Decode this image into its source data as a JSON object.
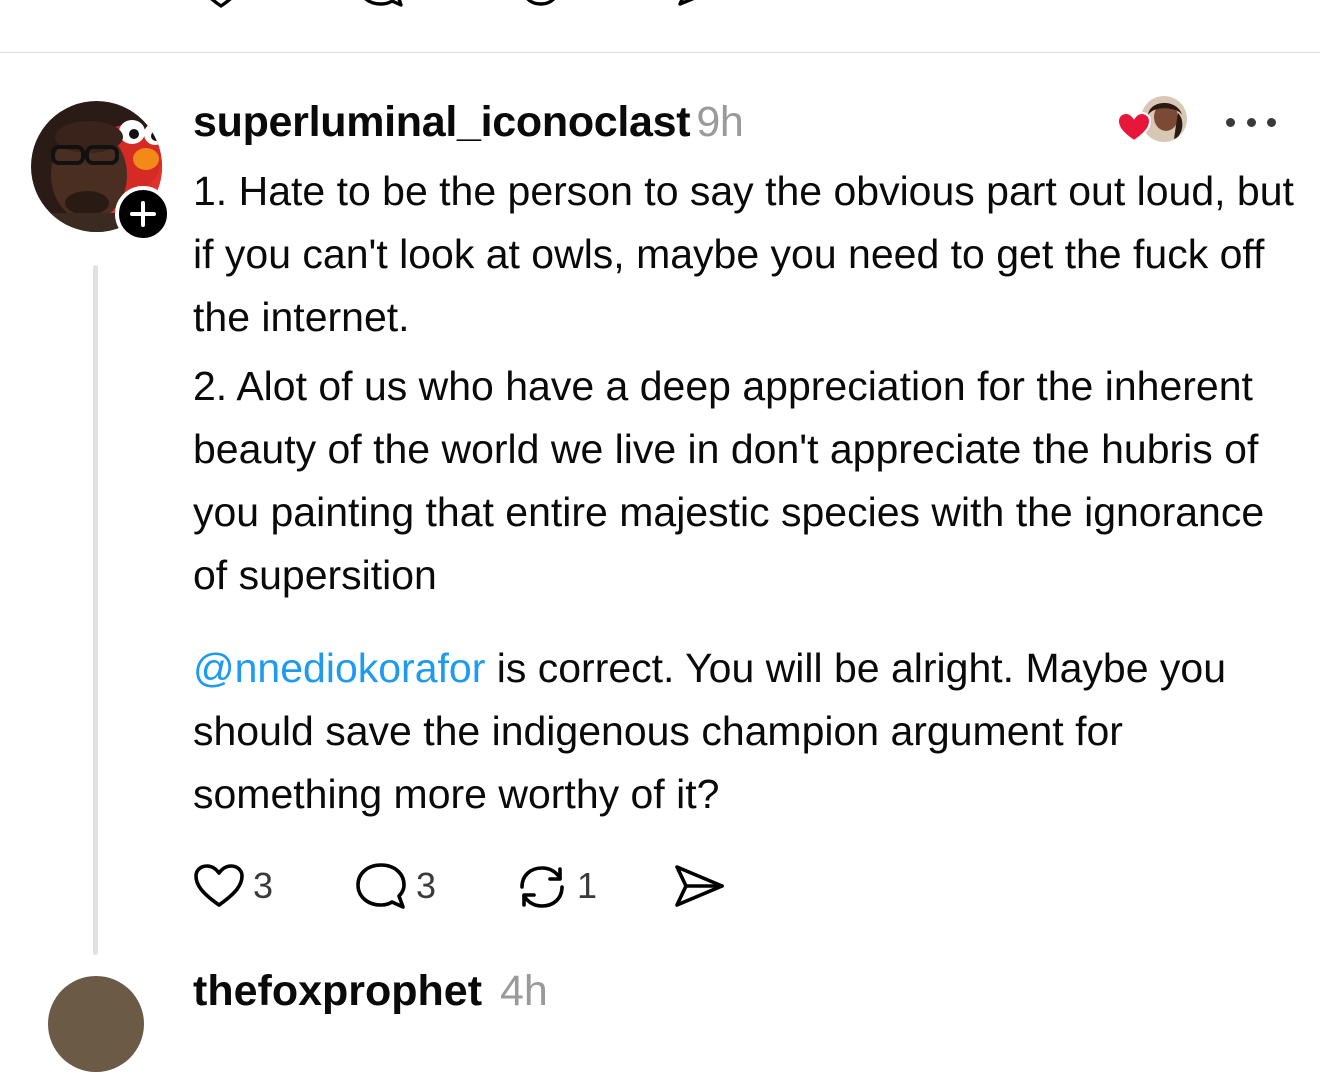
{
  "post": {
    "username": "superluminal_iconoclast",
    "timestamp": "9h",
    "paragraph1": "1. Hate to be the person to say the obvious part out loud, but if you can't look at owls, maybe you need to get the fuck off the internet.",
    "paragraph2": "2. Alot of us who have a deep appreciation for the inherent beauty of the world we live in don't appreciate the hubris of you painting that entire majestic species with the ignorance of supersition",
    "mention": "@nnediokorafor",
    "paragraph3_rest": " is correct.  You will be alright. Maybe you should save the indigenous champion argument for something more worthy of it?",
    "likes": "3",
    "replies": "3",
    "reposts": "1"
  },
  "next_post": {
    "username": "thefoxprophet",
    "timestamp": "4h"
  },
  "colors": {
    "mention": "#1d9bf0",
    "timestamp": "#9a9a9a",
    "heart_badge": "#e8163a",
    "divider": "#dcdcdc"
  },
  "icons": {
    "like": "heart-icon",
    "reply": "comment-icon",
    "repost": "repost-icon",
    "share": "send-icon",
    "more": "more-icon",
    "follow": "plus-icon"
  }
}
